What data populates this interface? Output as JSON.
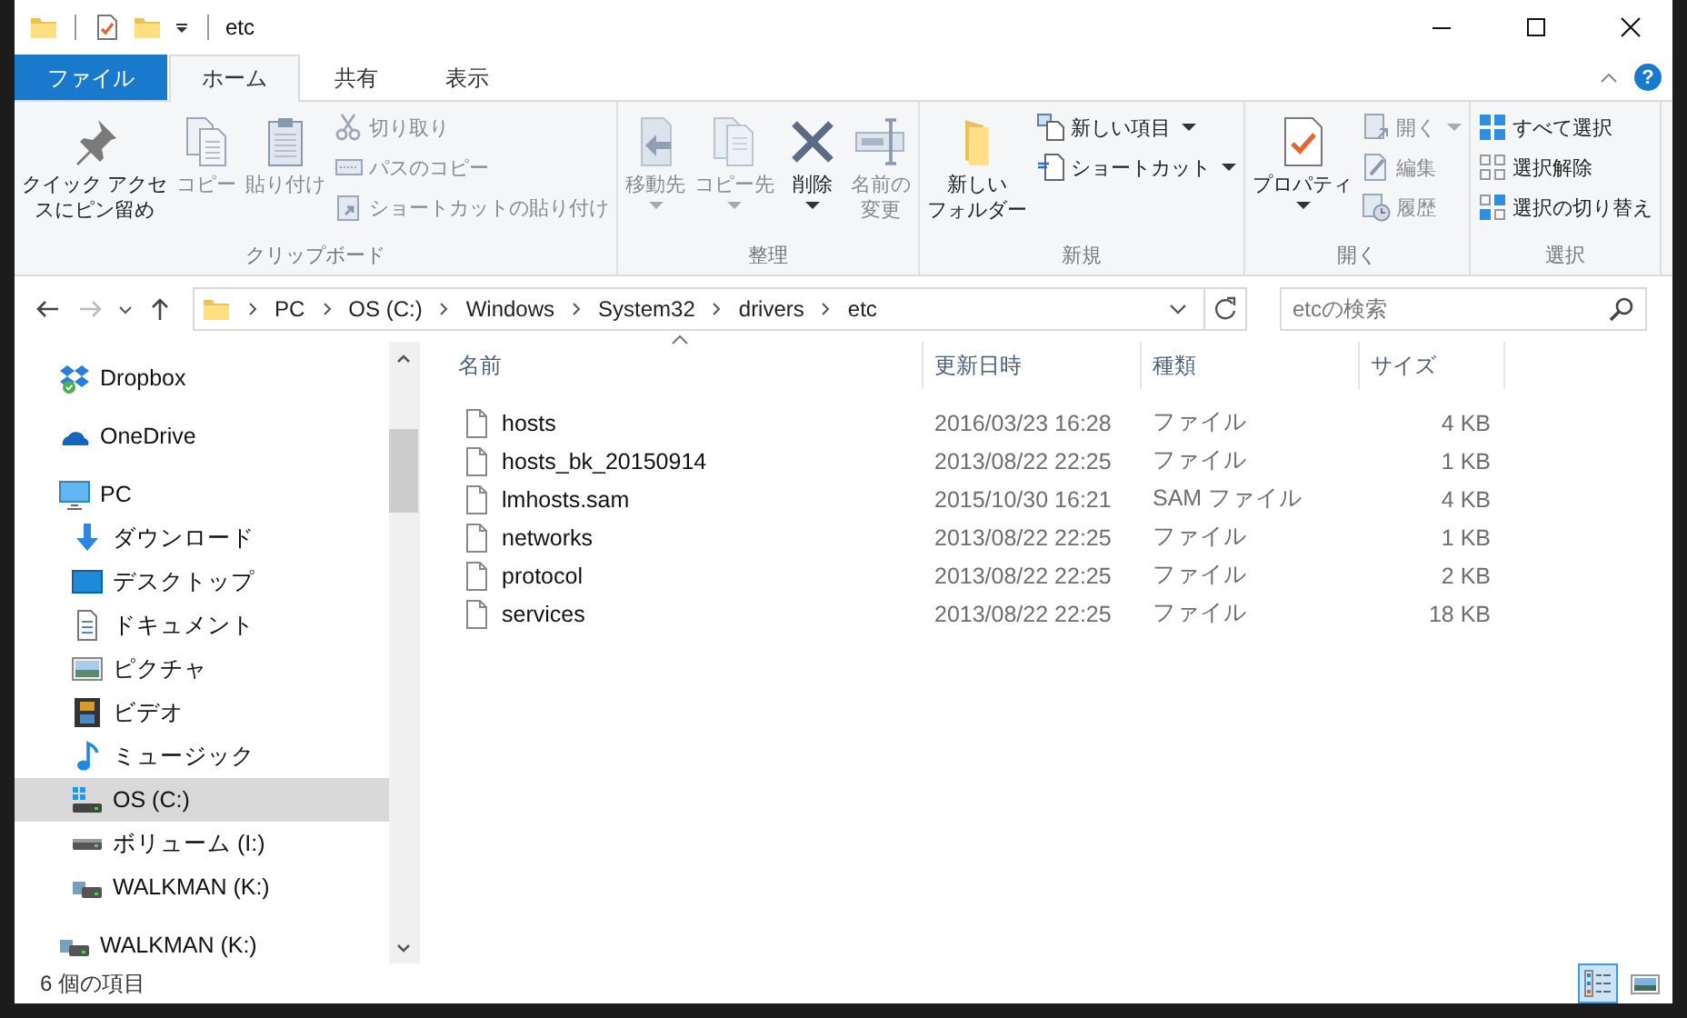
{
  "window": {
    "title": "etc"
  },
  "ribbon_tabs": [
    {
      "label": "ファイル",
      "kind": "file",
      "selected": false
    },
    {
      "label": "ホーム",
      "kind": "tab",
      "selected": true
    },
    {
      "label": "共有",
      "kind": "tab",
      "selected": false
    },
    {
      "label": "表示",
      "kind": "tab",
      "selected": false
    }
  ],
  "help": "?",
  "ribbon": {
    "groups": [
      {
        "label": "クリップボード",
        "columns": [
          {
            "kind": "large",
            "lines": [
              "クイック アクセ",
              "スにピン留め"
            ],
            "disabled": false,
            "dropdown": false
          },
          {
            "kind": "large",
            "lines": [
              "コピー"
            ],
            "disabled": true,
            "dropdown": false
          },
          {
            "kind": "large",
            "lines": [
              "貼り付け"
            ],
            "disabled": true,
            "dropdown": false
          },
          {
            "kind": "stack",
            "items": [
              {
                "label": "切り取り",
                "disabled": true,
                "dropdown": false
              },
              {
                "label": "パスのコピー",
                "disabled": true,
                "dropdown": false
              },
              {
                "label": "ショートカットの貼り付け",
                "disabled": true,
                "dropdown": false
              }
            ]
          }
        ]
      },
      {
        "label": "整理",
        "columns": [
          {
            "kind": "large",
            "lines": [
              "移動先"
            ],
            "disabled": true,
            "dropdown": true
          },
          {
            "kind": "large",
            "lines": [
              "コピー先"
            ],
            "disabled": true,
            "dropdown": true
          },
          {
            "kind": "large",
            "lines": [
              "削除"
            ],
            "disabled": false,
            "dropdown": true
          },
          {
            "kind": "large",
            "lines": [
              "名前の",
              "変更"
            ],
            "disabled": true,
            "dropdown": false
          }
        ]
      },
      {
        "label": "新規",
        "columns": [
          {
            "kind": "large",
            "lines": [
              "新しい",
              "フォルダー"
            ],
            "disabled": false,
            "dropdown": false
          },
          {
            "kind": "stack",
            "items": [
              {
                "label": "新しい項目",
                "disabled": false,
                "dropdown": true
              },
              {
                "label": "ショートカット",
                "disabled": false,
                "dropdown": true
              }
            ]
          }
        ]
      },
      {
        "label": "開く",
        "columns": [
          {
            "kind": "large",
            "lines": [
              "プロパティ"
            ],
            "disabled": false,
            "dropdown": true
          },
          {
            "kind": "stack",
            "items": [
              {
                "label": "開く",
                "disabled": true,
                "dropdown": true
              },
              {
                "label": "編集",
                "disabled": true,
                "dropdown": false
              },
              {
                "label": "履歴",
                "disabled": true,
                "dropdown": false
              }
            ]
          }
        ]
      },
      {
        "label": "選択",
        "columns": [
          {
            "kind": "stack",
            "items": [
              {
                "label": "すべて選択",
                "disabled": false,
                "dropdown": false
              },
              {
                "label": "選択解除",
                "disabled": false,
                "dropdown": false
              },
              {
                "label": "選択の切り替え",
                "disabled": false,
                "dropdown": false
              }
            ]
          }
        ]
      }
    ]
  },
  "address": {
    "path": [
      "PC",
      "OS (C:)",
      "Windows",
      "System32",
      "drivers",
      "etc"
    ]
  },
  "search": {
    "placeholder": "etcの検索"
  },
  "sidebar": {
    "items": [
      {
        "label": "Dropbox",
        "selected": false
      },
      {
        "label": "OneDrive",
        "selected": false
      },
      {
        "label": "PC",
        "selected": false,
        "children": [
          {
            "label": "ダウンロード",
            "selected": false
          },
          {
            "label": "デスクトップ",
            "selected": false
          },
          {
            "label": "ドキュメント",
            "selected": false
          },
          {
            "label": "ピクチャ",
            "selected": false
          },
          {
            "label": "ビデオ",
            "selected": false
          },
          {
            "label": "ミュージック",
            "selected": false
          },
          {
            "label": "OS (C:)",
            "selected": true
          },
          {
            "label": "ボリューム (I:)",
            "selected": false
          },
          {
            "label": "WALKMAN (K:)",
            "selected": false
          }
        ]
      },
      {
        "label": "WALKMAN (K:)",
        "selected": false
      }
    ]
  },
  "table": {
    "columns": [
      "名前",
      "更新日時",
      "種類",
      "サイズ"
    ],
    "rows": [
      [
        "hosts",
        "2016/03/23 16:28",
        "ファイル",
        "4 KB"
      ],
      [
        "hosts_bk_20150914",
        "2013/08/22 22:25",
        "ファイル",
        "1 KB"
      ],
      [
        "lmhosts.sam",
        "2015/10/30 16:21",
        "SAM ファイル",
        "4 KB"
      ],
      [
        "networks",
        "2013/08/22 22:25",
        "ファイル",
        "1 KB"
      ],
      [
        "protocol",
        "2013/08/22 22:25",
        "ファイル",
        "2 KB"
      ],
      [
        "services",
        "2013/08/22 22:25",
        "ファイル",
        "18 KB"
      ]
    ]
  },
  "status_bar": {
    "text": "6 個の項目",
    "views": [
      {
        "selected": true
      },
      {
        "selected": false
      }
    ]
  }
}
